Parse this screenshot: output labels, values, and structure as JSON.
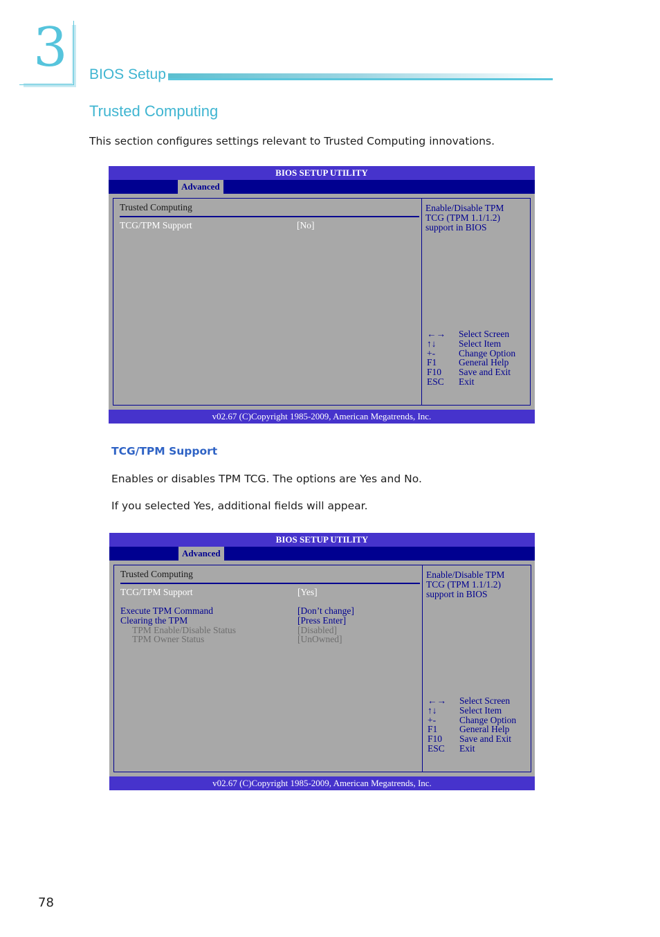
{
  "chapter": {
    "number": "3",
    "title": "BIOS Setup"
  },
  "section": {
    "title": "Trusted Computing",
    "intro": "This section configures settings relevant to Trusted Computing innovations."
  },
  "screens": [
    {
      "title": "BIOS SETUP UTILITY",
      "tab": "Advanced",
      "heading": "Trusted Computing",
      "items": [
        {
          "label": "TCG/TPM Support",
          "value": "[No]",
          "state": "selected"
        }
      ],
      "help": [
        "Enable/Disable TPM",
        "TCG (TPM 1.1/1.2)",
        "support in BIOS"
      ],
      "keys": [
        {
          "key": "←→",
          "action": "Select Screen"
        },
        {
          "key": "↑↓",
          "action": "Select Item"
        },
        {
          "key": "+-",
          "action": "Change Option"
        },
        {
          "key": "F1",
          "action": "General Help"
        },
        {
          "key": "F10",
          "action": "Save and Exit"
        },
        {
          "key": "ESC",
          "action": "Exit"
        }
      ],
      "footer": "v02.67 (C)Copyright 1985-2009, American Megatrends, Inc."
    },
    {
      "title": "BIOS SETUP UTILITY",
      "tab": "Advanced",
      "heading": "Trusted Computing",
      "items": [
        {
          "label": "TCG/TPM Support",
          "value": "[Yes]",
          "state": "selected"
        },
        {
          "label": "Execute TPM Command",
          "value": "[Don’t change]",
          "state": "option"
        },
        {
          "label": "Clearing the TPM",
          "value": "[Press Enter]",
          "state": "option"
        },
        {
          "label": "TPM Enable/Disable Status",
          "value": "[Disabled]",
          "state": "disabled"
        },
        {
          "label": "TPM Owner Status",
          "value": "[UnOwned]",
          "state": "disabled"
        }
      ],
      "help": [
        "Enable/Disable TPM",
        "TCG (TPM 1.1/1.2)",
        "support in BIOS"
      ],
      "keys": [
        {
          "key": "←→",
          "action": "Select Screen"
        },
        {
          "key": "↑↓",
          "action": "Select Item"
        },
        {
          "key": "+-",
          "action": "Change Option"
        },
        {
          "key": "F1",
          "action": "General Help"
        },
        {
          "key": "F10",
          "action": "Save and Exit"
        },
        {
          "key": "ESC",
          "action": "Exit"
        }
      ],
      "footer": "v02.67 (C)Copyright 1985-2009, American Megatrends, Inc."
    }
  ],
  "tcg_section": {
    "title": "TCG/TPM Support",
    "desc1": "Enables or disables TPM TCG. The options are Yes and No.",
    "desc2": "If you selected Yes, additional fields will appear."
  },
  "page_number": "78",
  "colors": {
    "accent": "#3fb5d1",
    "bios_title": "#4633cc",
    "bios_tabbar": "#000090",
    "bios_bg": "#a8a8a8",
    "subheading": "#2f63c5"
  }
}
